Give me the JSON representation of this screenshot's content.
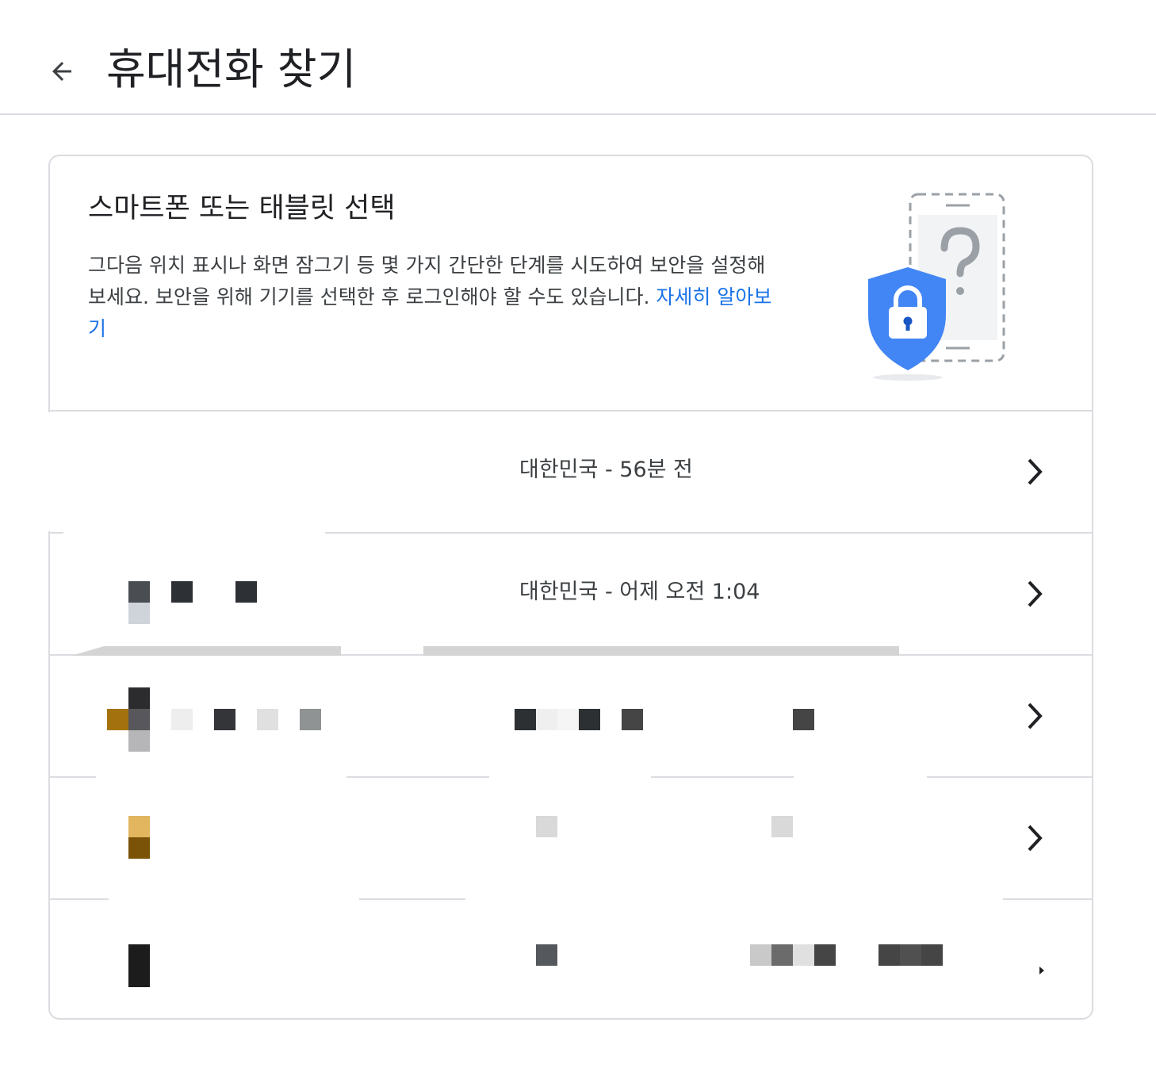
{
  "header": {
    "title": "휴대전화 찾기",
    "back_icon": "arrow-back-icon"
  },
  "intro": {
    "title": "스마트폰 또는 태블릿 선택",
    "description": "그다음 위치 표시나 화면 잠그기 등 몇 가지 간단한 단계를 시도하여 보안을 설정해 보세요. 보안을 위해 기기를 선택한 후 로그인해야 할 수도 있습니다. ",
    "learn_more": "자세히 알아보기",
    "illustration_icon": "phone-security-shield-icon"
  },
  "devices": [
    {
      "status": "대한민국 - 56분 전"
    },
    {
      "status": "대한민국 - 어제 오전 1:04"
    },
    {
      "status": ""
    },
    {
      "status": ""
    },
    {
      "status": ""
    }
  ],
  "colors": {
    "accent": "#1a73e8",
    "shield": "#4285f4",
    "divider": "#dadce0",
    "text_primary": "#202124",
    "text_secondary": "#3c4043"
  }
}
